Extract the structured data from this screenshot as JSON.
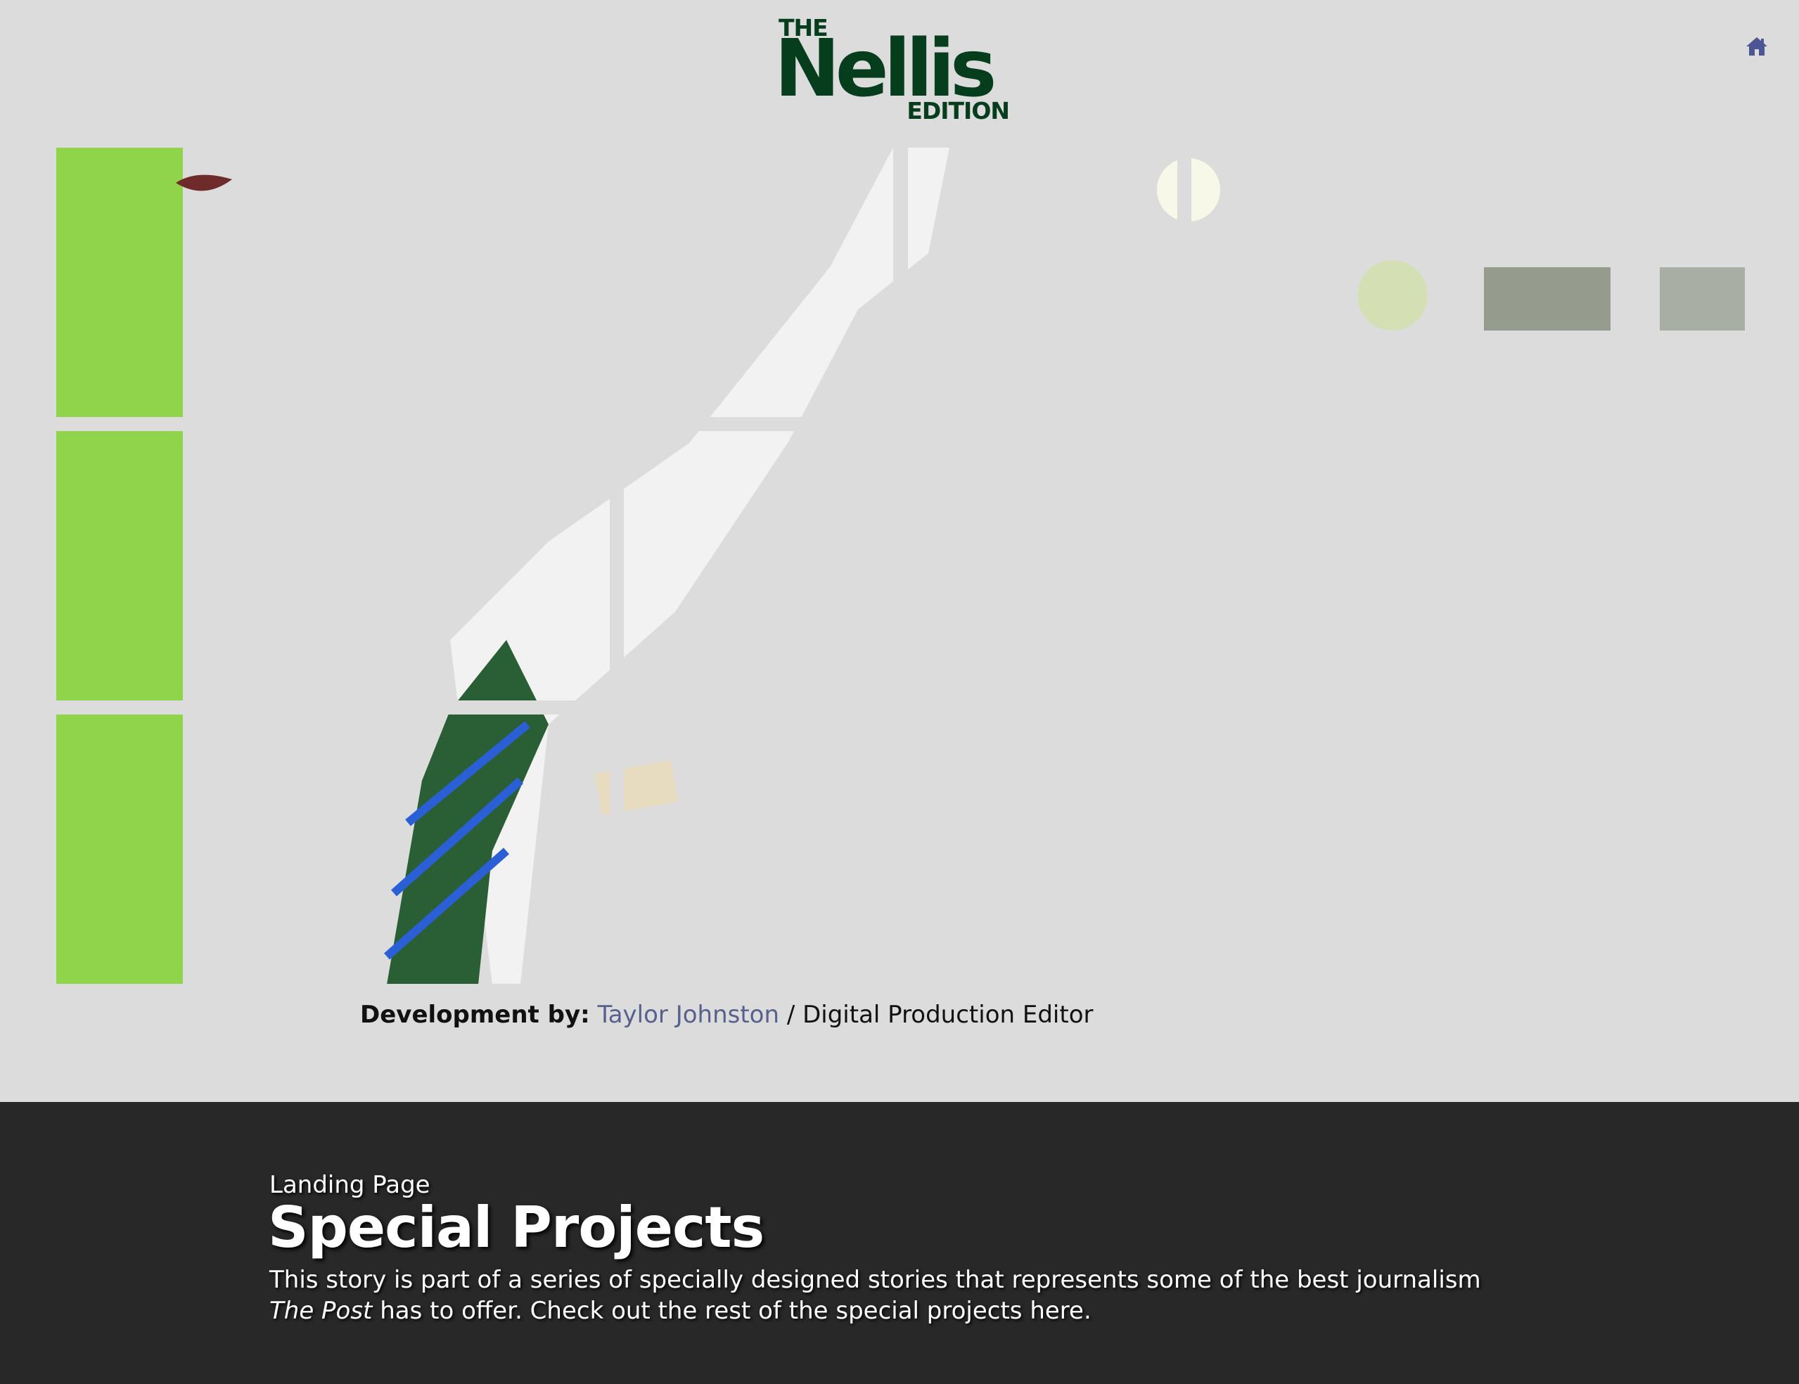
{
  "logo": {
    "the": "THE",
    "name": "Nellis",
    "edition": "EDITION",
    "color": "#063d1c"
  },
  "header": {
    "home_icon": "home-icon",
    "accent": "#4d5594"
  },
  "photo": {
    "rows": 3,
    "cols": 6,
    "description_colors": {
      "suit": "#131a2e",
      "shirt": "#f2f2f2",
      "tie": "#2a5f35",
      "tie_stripe": "#2b5fd6",
      "background_green": "#8be034"
    }
  },
  "credit": {
    "label": "Development by:",
    "name": "Taylor Johnston",
    "role": "/ Digital Production Editor"
  },
  "footer": {
    "kicker": "Landing Page",
    "title": "Special Projects",
    "desc_before": "This story is part of a series of specially designed stories that represents some of the best journalism",
    "desc_em": "The Post",
    "desc_after": "has to offer. Check out the rest of the special projects here."
  }
}
